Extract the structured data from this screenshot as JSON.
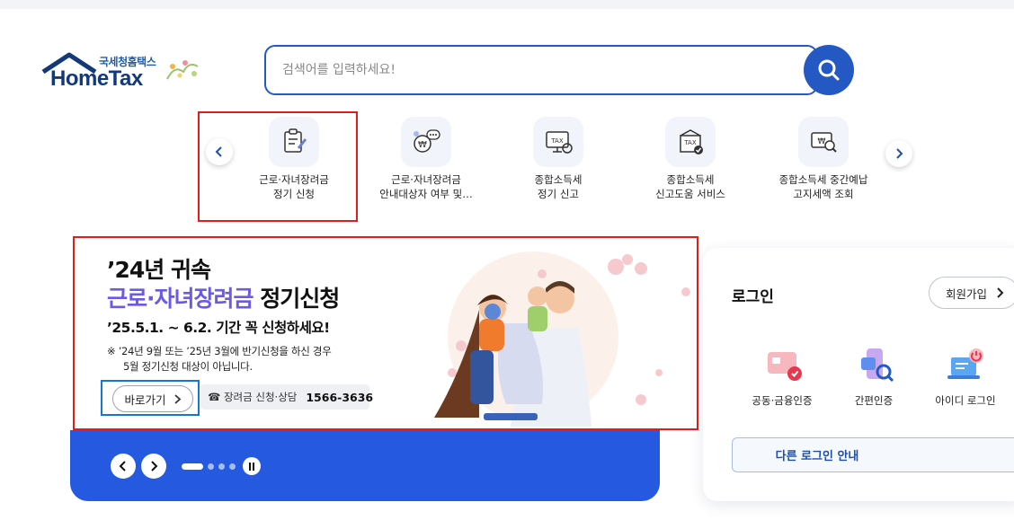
{
  "logo": {
    "subtitle": "국세청홈택스",
    "title": "HomeTax"
  },
  "search": {
    "placeholder": "검색어를 입력하세요!"
  },
  "quick_menu": {
    "items": [
      {
        "line1": "근로·자녀장려금",
        "line2": "정기 신청",
        "icon": "document-pen-icon"
      },
      {
        "line1": "근로·자녀장려금",
        "line2": "안내대상자 여부 및…",
        "icon": "won-chat-icon"
      },
      {
        "line1": "종합소득세",
        "line2": "정기 신고",
        "icon": "tax-monitor-icon"
      },
      {
        "line1": "종합소득세",
        "line2": "신고도움 서비스",
        "icon": "tax-check-icon"
      },
      {
        "line1": "종합소득세 중간예납",
        "line2": "고지세액 조회",
        "icon": "won-search-icon"
      }
    ]
  },
  "banner": {
    "title_line1": "’24년 귀속",
    "title_accent": "근로·자녀장려금",
    "title_rest": "정기신청",
    "period": "’25.5.1. ~ 6.2. 기간 꼭 신청하세요!",
    "note_line1": "※  ’24년 9월 또는 ’25년 3월에 반기신청을 하신 경우",
    "note_line2": "5월 정기신청 대상이 아닙니다.",
    "go_button": "바로가기",
    "contact_label": "☎ 장려금 신청·상담",
    "contact_number": "1566-3636",
    "accent_color": "#6a5be0"
  },
  "carousel": {
    "slide_count": 5,
    "active_index": 0
  },
  "login": {
    "title": "로그인",
    "signup_button": "회원가입",
    "options": [
      {
        "label": "공동·금융인증",
        "icon": "certificate-card-icon"
      },
      {
        "label": "간편인증",
        "icon": "phone-auth-icon"
      },
      {
        "label": "아이디 로그인",
        "icon": "laptop-power-icon"
      }
    ],
    "other_login": "다른 로그인 안내"
  },
  "colors": {
    "primary": "#2459c4",
    "brand_navy": "#14397a",
    "highlight_red": "#e31b1b",
    "highlight_blue": "#1676d2"
  }
}
